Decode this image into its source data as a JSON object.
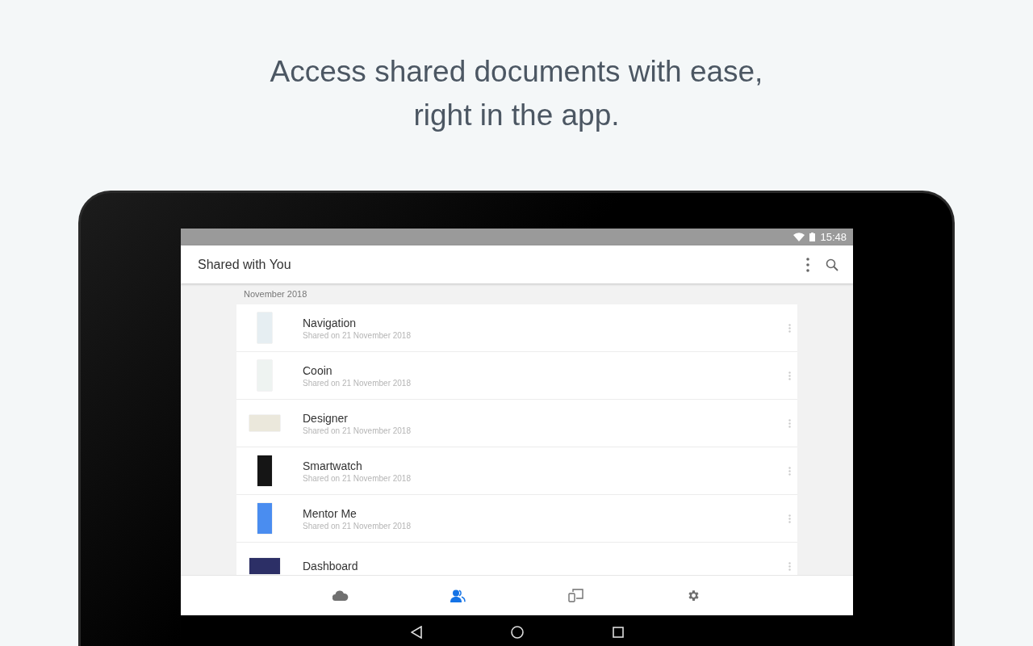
{
  "headline": "Access shared documents with ease,\nright in the app.",
  "status_bar": {
    "time": "15:48"
  },
  "app_bar": {
    "title": "Shared with You"
  },
  "section": {
    "title": "November 2018"
  },
  "documents": [
    {
      "name": "Navigation",
      "shared": "Shared on 21 November 2018",
      "kind": "portrait",
      "color": "#e6eef2"
    },
    {
      "name": "Cooin",
      "shared": "Shared on 21 November 2018",
      "kind": "portrait",
      "color": "#eef3f1"
    },
    {
      "name": "Designer",
      "shared": "Shared on 21 November 2018",
      "kind": "landscape",
      "color": "#ebe8dc"
    },
    {
      "name": "Smartwatch",
      "shared": "Shared on 21 November 2018",
      "kind": "portrait",
      "color": "#151515"
    },
    {
      "name": "Mentor Me",
      "shared": "Shared on 21 November 2018",
      "kind": "portrait",
      "color": "#4a8df0"
    },
    {
      "name": "Dashboard",
      "kind": "landscape",
      "color": "#2c2f66"
    }
  ],
  "bottom_nav": [
    {
      "kind": "cloud",
      "selected": false
    },
    {
      "kind": "people",
      "selected": true
    },
    {
      "kind": "devices",
      "selected": false
    },
    {
      "kind": "settings",
      "selected": false
    }
  ]
}
